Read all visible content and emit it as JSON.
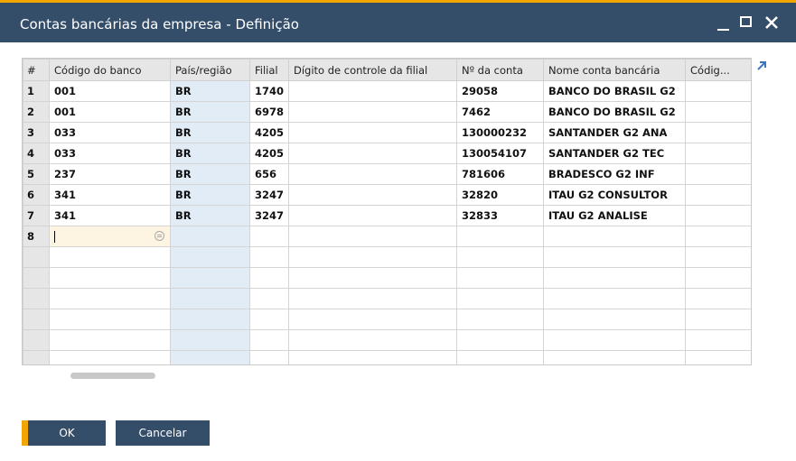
{
  "window": {
    "title": "Contas bancárias da empresa - Definição",
    "accent_color": "#f0a500",
    "titlebar_color": "#344e6a",
    "icons": {
      "minimize": "minimize-icon",
      "maximize": "maximize-icon",
      "close": "close-icon"
    }
  },
  "grid": {
    "columns": [
      "#",
      "Código do banco",
      "País/região",
      "Filial",
      "Dígito de controle da filial",
      "Nº da conta",
      "Nome conta bancária",
      "Códig..."
    ],
    "rows": [
      {
        "n": "1",
        "bank": "001",
        "country": "BR",
        "branch": "1740",
        "digit": "",
        "account": "29058",
        "name": "BANCO DO BRASIL G2",
        "code": ""
      },
      {
        "n": "2",
        "bank": "001",
        "country": "BR",
        "branch": "6978",
        "digit": "",
        "account": "7462",
        "name": "BANCO DO BRASIL G2",
        "code": ""
      },
      {
        "n": "3",
        "bank": "033",
        "country": "BR",
        "branch": "4205",
        "digit": "",
        "account": "130000232",
        "name": "SANTANDER G2 ANA",
        "code": ""
      },
      {
        "n": "4",
        "bank": "033",
        "country": "BR",
        "branch": "4205",
        "digit": "",
        "account": "130054107",
        "name": "SANTANDER G2 TEC",
        "code": ""
      },
      {
        "n": "5",
        "bank": "237",
        "country": "BR",
        "branch": "656",
        "digit": "",
        "account": "781606",
        "name": "BRADESCO G2 INF",
        "code": ""
      },
      {
        "n": "6",
        "bank": "341",
        "country": "BR",
        "branch": "3247",
        "digit": "",
        "account": "32820",
        "name": "ITAU G2 CONSULTOR",
        "code": ""
      },
      {
        "n": "7",
        "bank": "341",
        "country": "BR",
        "branch": "3247",
        "digit": "",
        "account": "32833",
        "name": "ITAU G2 ANALISE",
        "code": ""
      },
      {
        "n": "8",
        "bank": "",
        "country": "",
        "branch": "",
        "digit": "",
        "account": "",
        "name": "",
        "code": ""
      }
    ],
    "empty_rows": 6,
    "expand_icon": "expand-arrow-icon"
  },
  "buttons": {
    "ok": "OK",
    "cancel": "Cancelar"
  }
}
